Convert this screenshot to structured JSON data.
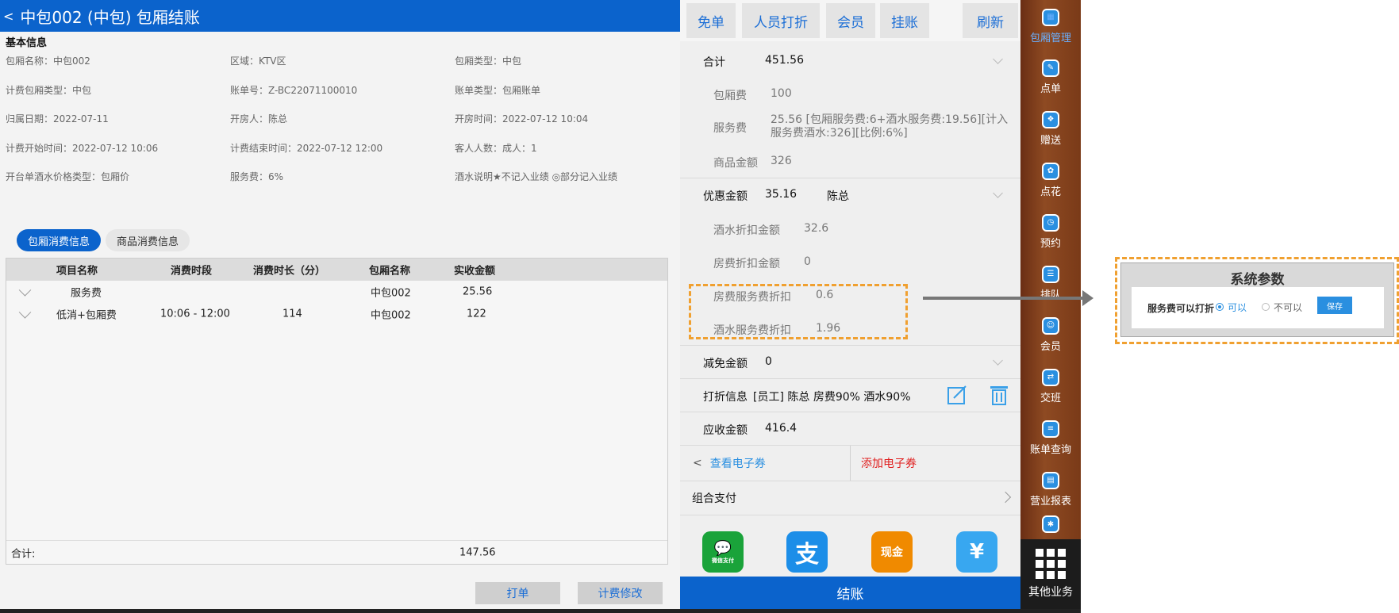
{
  "header": {
    "title": "中包002 (中包) 包厢结账",
    "back": "<"
  },
  "basic": {
    "section_title": "基本信息",
    "fields": [
      "包厢名称：中包002",
      "区域：KTV区",
      "包厢类型：中包",
      "计费包厢类型：中包",
      "账单号：Z-BC22071100010",
      "账单类型：包厢账单",
      "归属日期：2022-07-11",
      "开房人：陈总",
      "开房时间：2022-07-12 10:04",
      "计费开始时间：2022-07-12 10:06",
      "计费结束时间：2022-07-12 12:00",
      "客人人数：成人：1",
      "开台单酒水价格类型：包厢价",
      "服务费：6%",
      "酒水说明★不记入业绩 ◎部分记入业绩"
    ]
  },
  "tabs": [
    "包厢消费信息",
    "商品消费信息"
  ],
  "table": {
    "headers": [
      "项目名称",
      "消费时段",
      "消费时长（分）",
      "包厢名称",
      "实收金额"
    ],
    "rows": [
      [
        "服务费",
        "",
        "",
        "中包002",
        "25.56"
      ],
      [
        "低消+包厢费",
        "10:06 - 12:00",
        "114",
        "中包002",
        "122"
      ]
    ],
    "total_label": "合计:",
    "total_value": "147.56"
  },
  "left_buttons": {
    "print": "打单",
    "modify": "计费修改"
  },
  "top_buttons": [
    "免单",
    "人员打折",
    "会员",
    "挂账",
    "刷新"
  ],
  "summary": {
    "total_label": "合计",
    "total_value": "451.56",
    "room_fee_label": "包厢费",
    "room_fee_value": "100",
    "service_fee_label": "服务费",
    "service_fee_value": "25.56 [包厢服务费:6+酒水服务费:19.56][计入服务费酒水:326][比例:6%]",
    "goods_label": "商品金额",
    "goods_value": "326",
    "discount_label": "优惠金额",
    "discount_value": "35.16",
    "discount_person": "陈总",
    "drink_disc_label": "酒水折扣金额",
    "drink_disc_value": "32.6",
    "room_disc_label": "房费折扣金额",
    "room_disc_value": "0",
    "room_svc_disc_label": "房费服务费折扣",
    "room_svc_disc_value": "0.6",
    "drink_svc_disc_label": "酒水服务费折扣",
    "drink_svc_disc_value": "1.96",
    "waive_label": "减免金额",
    "waive_value": "0",
    "discount_info_label": "打折信息",
    "discount_info_value": "[员工] 陈总 房费90% 酒水90%",
    "receivable_label": "应收金额",
    "receivable_value": "416.4",
    "view_coupon": "查看电子券",
    "add_coupon": "添加电子券",
    "combo_pay": "组合支付",
    "checkout": "结账"
  },
  "pay_icons": [
    {
      "name": "wechat-pay-icon",
      "label": "微信支付",
      "color": "#1aa33a"
    },
    {
      "name": "alipay-icon",
      "label": "支",
      "color": "#1c8ee8"
    },
    {
      "name": "cash-icon",
      "label": "现金",
      "color": "#f08a00"
    },
    {
      "name": "yuan-icon",
      "label": "¥",
      "color": "#38a7f0"
    }
  ],
  "sidebar": [
    "包厢管理",
    "点单",
    "赠送",
    "点花",
    "预约",
    "排队",
    "会员",
    "交班",
    "账单查询",
    "营业报表",
    "",
    "其他业务"
  ],
  "dialog": {
    "title": "系统参数",
    "label": "服务费可以打折",
    "opt_yes": "可以",
    "opt_no": "不可以",
    "save": "保存"
  },
  "colors": {
    "primary": "#0b63cc",
    "accent": "#1b6ed6",
    "highlight": "#f0a030"
  }
}
